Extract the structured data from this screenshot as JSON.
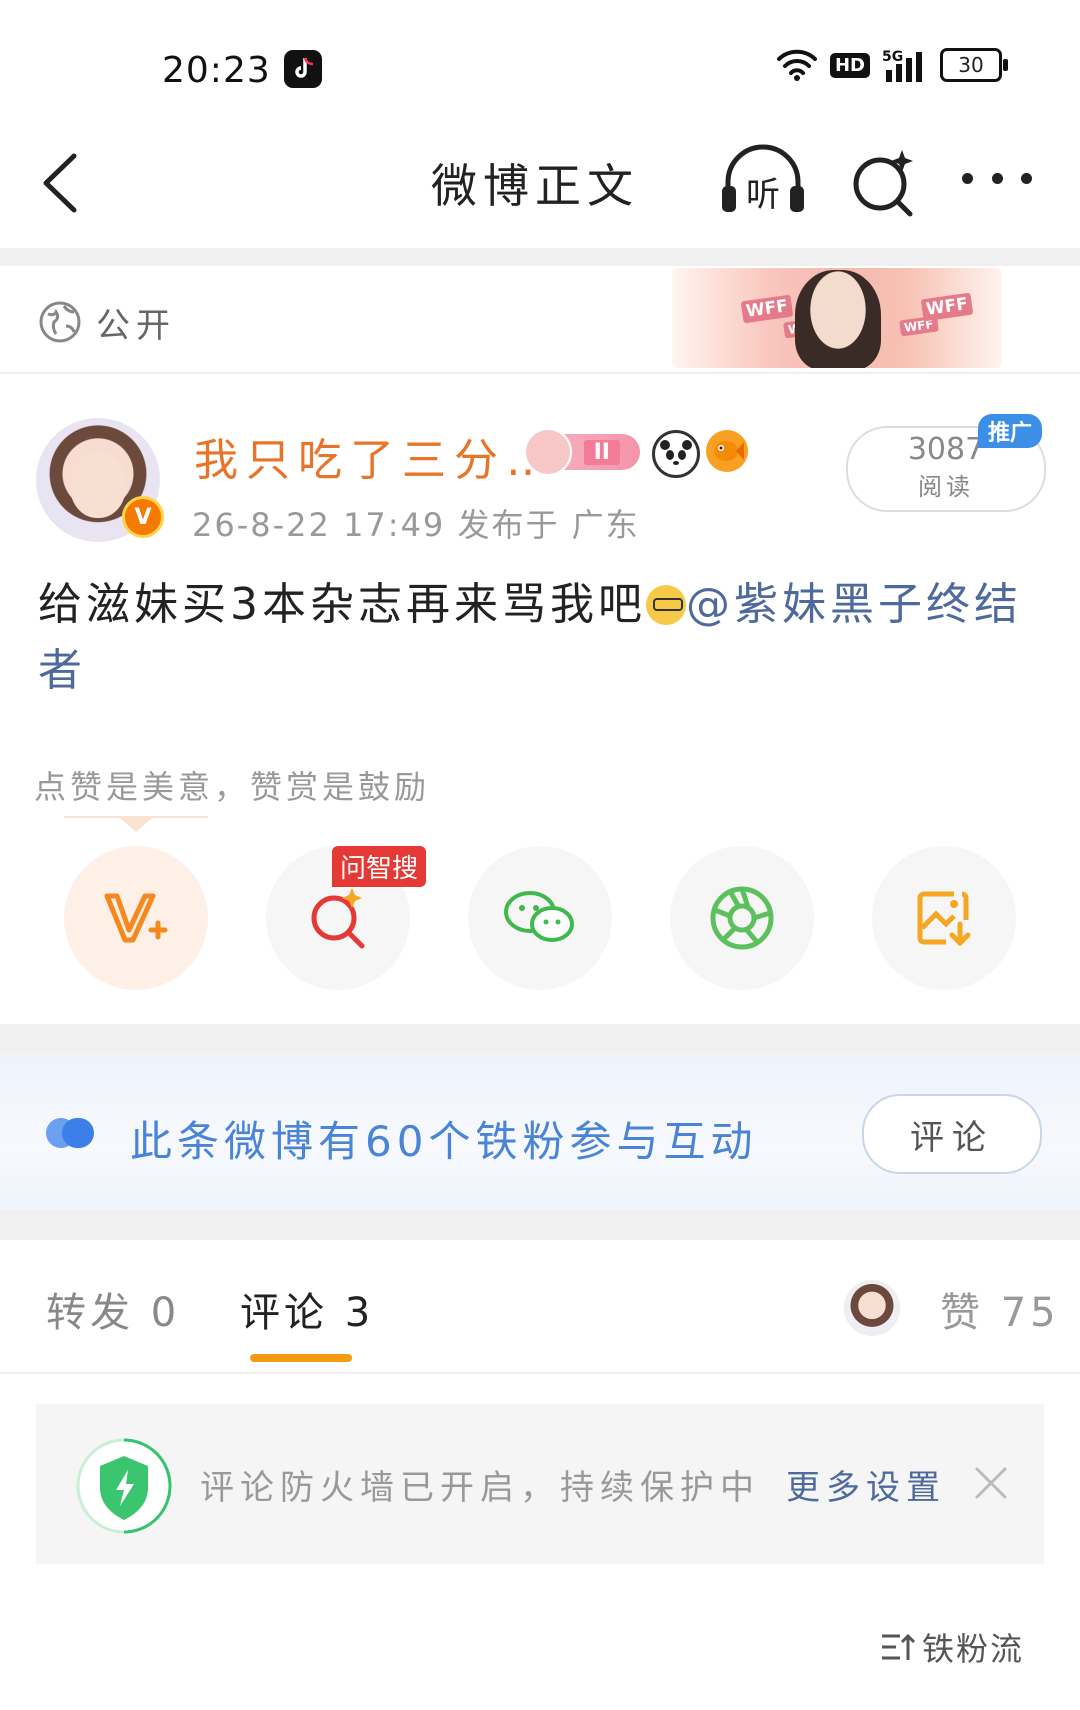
{
  "status_bar": {
    "time": "20:23",
    "app_icon": "tiktok-icon",
    "hd": "HD",
    "network": "5G",
    "battery": "30"
  },
  "nav": {
    "title": "微博正文",
    "listen_label": "听",
    "icons": [
      "back-icon",
      "listen-icon",
      "ai-search-icon",
      "more-icon"
    ]
  },
  "privacy": {
    "label": "公开",
    "banner_text": [
      "WFF",
      "WFF",
      "WFF",
      "WFF"
    ]
  },
  "author": {
    "name": "我只吃了三分…",
    "fan_level": "II",
    "verified": "V",
    "meta": "26-8-22 17:49  发布于 广东"
  },
  "read_count": {
    "number": "3087",
    "label": "阅读",
    "promo_tag": "推广"
  },
  "post": {
    "text": "给滋妹买3本杂志再来骂我吧",
    "mention": "@紫妹黑子终结者"
  },
  "reward": {
    "hint": "点赞是美意，赞赏是鼓励",
    "search_tag": "问智搜",
    "actions": [
      "vplus-icon",
      "smart-search-icon",
      "wechat-icon",
      "moments-icon",
      "save-image-icon"
    ]
  },
  "fan_interaction": {
    "text": "此条微博有60个铁粉参与互动",
    "button": "评论"
  },
  "tabs": {
    "repost": "转发 0",
    "comment": "评论 3",
    "like": "赞 75"
  },
  "firewall": {
    "text": "评论防火墙已开启，持续保护中",
    "link": "更多设置"
  },
  "sort": {
    "label": "铁粉流"
  },
  "colors": {
    "accent_orange": "#f39c12",
    "name_orange": "#e8742a",
    "link_blue": "#4e6a9c",
    "fan_blue": "#4a84d6"
  }
}
